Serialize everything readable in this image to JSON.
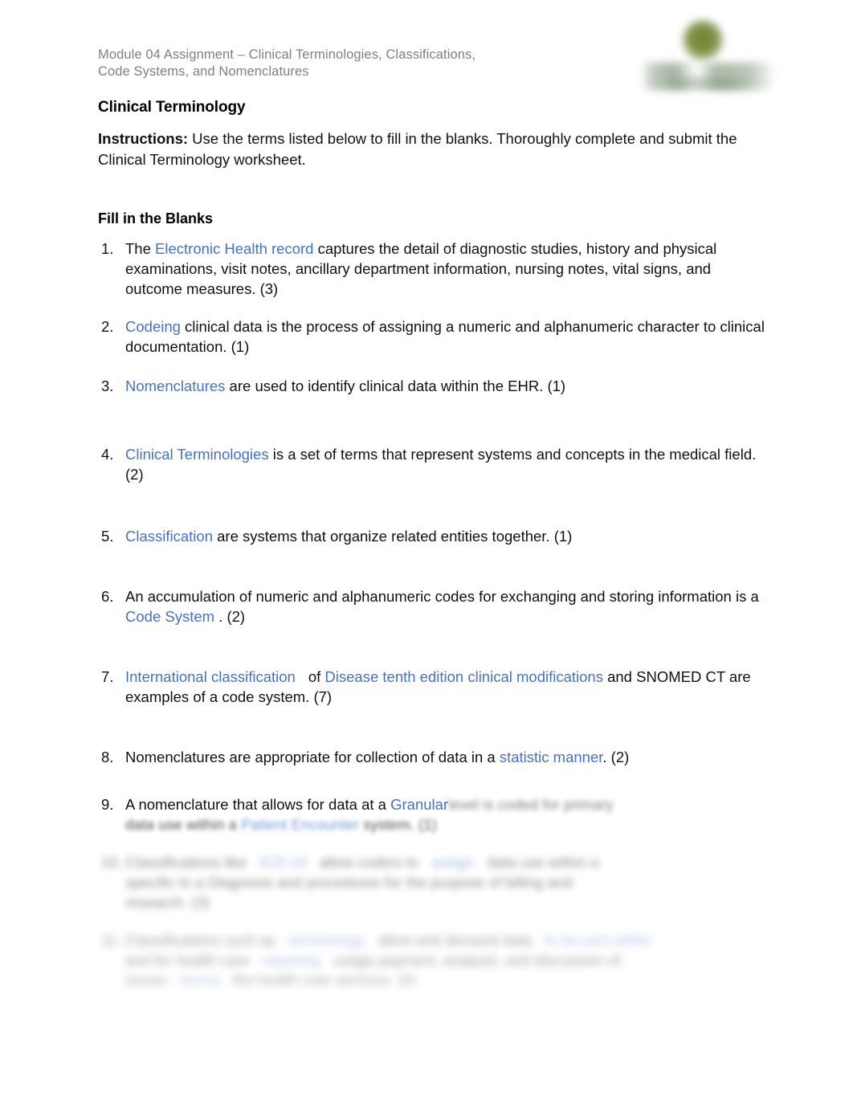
{
  "header": {
    "line1": "Module 04 Assignment – Clinical Terminologies, Classifications,",
    "line2": "Code Systems, and Nomenclatures",
    "logo_alt": "school-logo"
  },
  "title": "Clinical Terminology",
  "instructions": {
    "label": "Instructions:",
    "body": " Use the terms listed below to fill in the blanks. Thoroughly complete and submit the Clinical Terminology worksheet."
  },
  "section_heading": "Fill in the Blanks",
  "questions": [
    {
      "number": "1.",
      "parts": [
        {
          "type": "text",
          "value": "The "
        },
        {
          "type": "answer",
          "value": "Electronic Health record"
        },
        {
          "type": "text",
          "value": " captures the detail of diagnostic studies, history and physical examinations, visit notes, ancillary department information, nursing notes, vital signs, and outcome measures. (3)"
        }
      ]
    },
    {
      "number": "2.",
      "parts": [
        {
          "type": "answer",
          "value": "Codeing"
        },
        {
          "type": "text",
          "value": " clinical data is the process of assigning a numeric and alphanumeric character to clinical documentation. (1)"
        }
      ]
    },
    {
      "number": "3.",
      "parts": [
        {
          "type": "answer",
          "value": "Nomenclatures"
        },
        {
          "type": "text",
          "value": " are used to identify clinical data within the EHR. (1)"
        }
      ]
    },
    {
      "number": "4.",
      "parts": [
        {
          "type": "answer",
          "value": "Clinical Terminologies"
        },
        {
          "type": "text",
          "value": " is a set of terms that represent systems and concepts in the medical field. (2)"
        }
      ]
    },
    {
      "number": "5.",
      "parts": [
        {
          "type": "answer",
          "value": "Classification"
        },
        {
          "type": "text",
          "value": " are systems that organize related entities together. (1)"
        }
      ]
    },
    {
      "number": "6.",
      "parts": [
        {
          "type": "text",
          "value": "An accumulation of numeric and alphanumeric codes for exchanging and storing information is a "
        },
        {
          "type": "answer",
          "value": "Code System"
        },
        {
          "type": "text",
          "value": " . (2)"
        }
      ]
    },
    {
      "number": "7.",
      "parts": [
        {
          "type": "answer",
          "value": "International classification"
        },
        {
          "type": "gap",
          "value": ""
        },
        {
          "type": "text",
          "value": "of "
        },
        {
          "type": "answer",
          "value": "Disease tenth edition clinical modifications"
        },
        {
          "type": "text",
          "value": " and SNOMED CT are examples of a code system. (7)"
        }
      ]
    },
    {
      "number": "8.",
      "parts": [
        {
          "type": "text",
          "value": "Nomenclatures are appropriate for collection of data in a "
        },
        {
          "type": "answer",
          "value": "statistic manner"
        },
        {
          "type": "text",
          "value": ". (2)"
        }
      ]
    }
  ],
  "question9": {
    "number": "9.",
    "visible_text": "A nomenclature that allows for data at a ",
    "answer": "Granular",
    "obscured_tail": "level is coded for primary",
    "obscured_line2_a": "data use within a ",
    "obscured_line2_answer": "Patient Encounter",
    "obscured_line2_b": " system. (1)"
  },
  "obscured_items": [
    {
      "number": "10.",
      "lines": [
        "Classifications like",
        "ICD-10",
        "allow coders to",
        "assign",
        "data use within a",
        "",
        "specific to a Diagnosis and procedures for the purpose of billing and",
        "research. (3)"
      ]
    },
    {
      "number": "11.",
      "lines": [
        "Classifications such as",
        "terminology",
        "allow and demand data",
        "to be sent within",
        "and for health care",
        "reporting",
        "usage payment, analysis, and discussion of",
        "issues",
        "facing",
        "the health care services. (4)"
      ]
    }
  ],
  "colors": {
    "answer_blue": "#4472C4",
    "header_gray": "#808080",
    "body_text": "#111111",
    "logo_green": "#6f8732"
  }
}
